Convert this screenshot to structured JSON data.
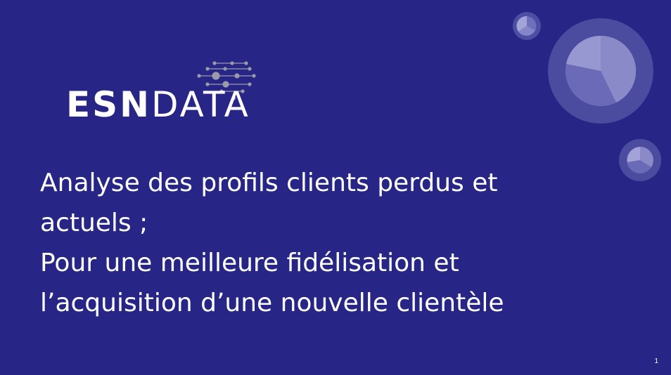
{
  "logo": {
    "text_bold": "ESN",
    "text_light": "DATA"
  },
  "title": {
    "line1": "Analyse des profils clients perdus et",
    "line2": "actuels ;",
    "line3": "Pour une meilleure fidélisation et",
    "line4": "l’acquisition d’une nouvelle clientèle"
  },
  "page_number": "1",
  "colors": {
    "background": "#272687",
    "text": "#ffffff",
    "decoration": "#8b8bd0"
  },
  "icons": [
    "network-dots-icon",
    "pie-chart-icon"
  ]
}
